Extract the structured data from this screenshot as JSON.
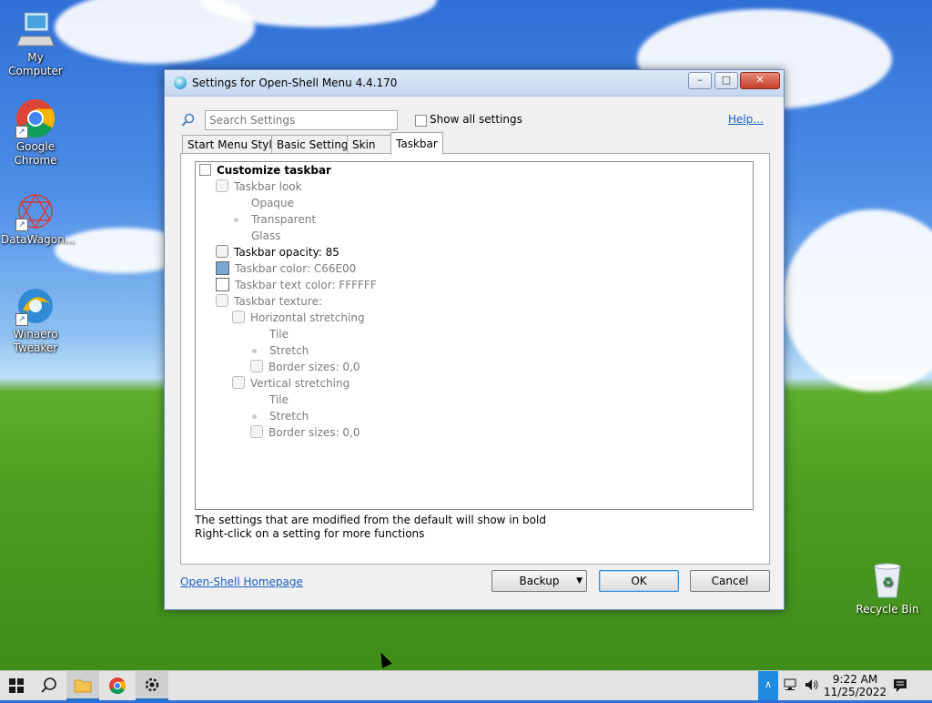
{
  "desktop": {
    "icons": [
      {
        "label": "My Computer"
      },
      {
        "label": "Google Chrome"
      },
      {
        "label": "DataWagon..."
      },
      {
        "label": "Winaero Tweaker"
      },
      {
        "label": "Recycle Bin"
      }
    ]
  },
  "window": {
    "title": "Settings for Open-Shell Menu 4.4.170",
    "search_placeholder": "Search Settings",
    "show_all_label": "Show all settings",
    "help_label": "Help...",
    "tabs": [
      {
        "label": "Start Menu Style"
      },
      {
        "label": "Basic Settings"
      },
      {
        "label": "Skin"
      },
      {
        "label": "Taskbar",
        "active": true
      }
    ],
    "tree": [
      {
        "label": "Customize taskbar"
      },
      {
        "label": "Taskbar look"
      },
      {
        "label": "Opaque"
      },
      {
        "label": "Transparent"
      },
      {
        "label": "Glass"
      },
      {
        "label": "Taskbar opacity: 85"
      },
      {
        "label": "Taskbar color: C66E00",
        "swatch": "#7ba7d7"
      },
      {
        "label": "Taskbar text color: FFFFFF",
        "swatch": "#ffffff"
      },
      {
        "label": "Taskbar texture:"
      },
      {
        "label": "Horizontal stretching"
      },
      {
        "label": "Tile"
      },
      {
        "label": "Stretch"
      },
      {
        "label": "Border sizes: 0,0"
      },
      {
        "label": "Vertical stretching"
      },
      {
        "label": "Tile"
      },
      {
        "label": "Stretch"
      },
      {
        "label": "Border sizes: 0,0"
      }
    ],
    "info_line1": "The settings that are modified from the default will show in bold",
    "info_line2": "Right-click on a setting for more functions",
    "homepage_link": "Open-Shell Homepage",
    "buttons": {
      "backup": "Backup",
      "ok": "OK",
      "cancel": "Cancel"
    }
  },
  "taskbar": {
    "time": "9:22 AM",
    "date": "11/25/2022"
  }
}
